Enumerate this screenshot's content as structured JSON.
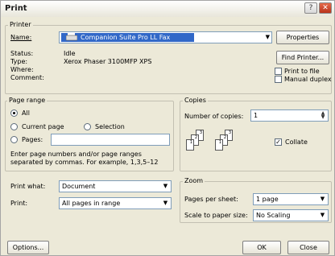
{
  "window": {
    "title": "Print"
  },
  "printer": {
    "group_label": "Printer",
    "name_label": "Name:",
    "selected": "Companion Suite Pro LL Fax",
    "properties": "Properties",
    "status_label": "Status:",
    "status_value": "Idle",
    "type_label": "Type:",
    "type_value": "Xerox Phaser 3100MFP XPS",
    "where_label": "Where:",
    "comment_label": "Comment:",
    "find_printer": "Find Printer...",
    "print_to_file": "Print to file",
    "manual_duplex": "Manual duplex"
  },
  "page_range": {
    "group_label": "Page range",
    "all": "All",
    "current_page": "Current page",
    "selection": "Selection",
    "pages": "Pages:",
    "hint_line1": "Enter page numbers and/or page ranges",
    "hint_line2": "separated by commas.  For example, 1,3,5–12"
  },
  "copies": {
    "group_label": "Copies",
    "number_label": "Number of copies:",
    "number_value": "1",
    "collate": "Collate"
  },
  "print_what": {
    "label": "Print what:",
    "value": "Document"
  },
  "print_range": {
    "label": "Print:",
    "value": "All pages in range"
  },
  "zoom": {
    "group_label": "Zoom",
    "pages_label": "Pages per sheet:",
    "pages_value": "1 page",
    "scale_label": "Scale to paper size:",
    "scale_value": "No Scaling"
  },
  "footer": {
    "options": "Options...",
    "ok": "OK",
    "close": "Close"
  },
  "collate_pages": [
    "3",
    "2",
    "1",
    "3",
    "2",
    "1"
  ]
}
